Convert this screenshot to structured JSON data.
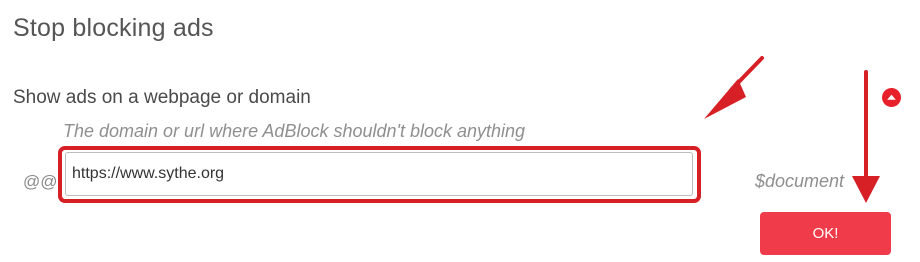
{
  "dialog": {
    "title": "Stop blocking ads"
  },
  "section": {
    "label": "Show ads on a webpage or domain",
    "hint": "The domain or url where AdBlock shouldn't block anything"
  },
  "filter": {
    "prefix": "@@",
    "url_value": "https://www.sythe.org",
    "suffix": "$document"
  },
  "actions": {
    "ok_label": "OK!"
  },
  "icons": {
    "collapse": "chevron-up-circle-icon"
  },
  "colors": {
    "accent": "#f03c4a",
    "annotation": "#d71f26",
    "text": "#555555",
    "muted": "#8f8f8f"
  }
}
